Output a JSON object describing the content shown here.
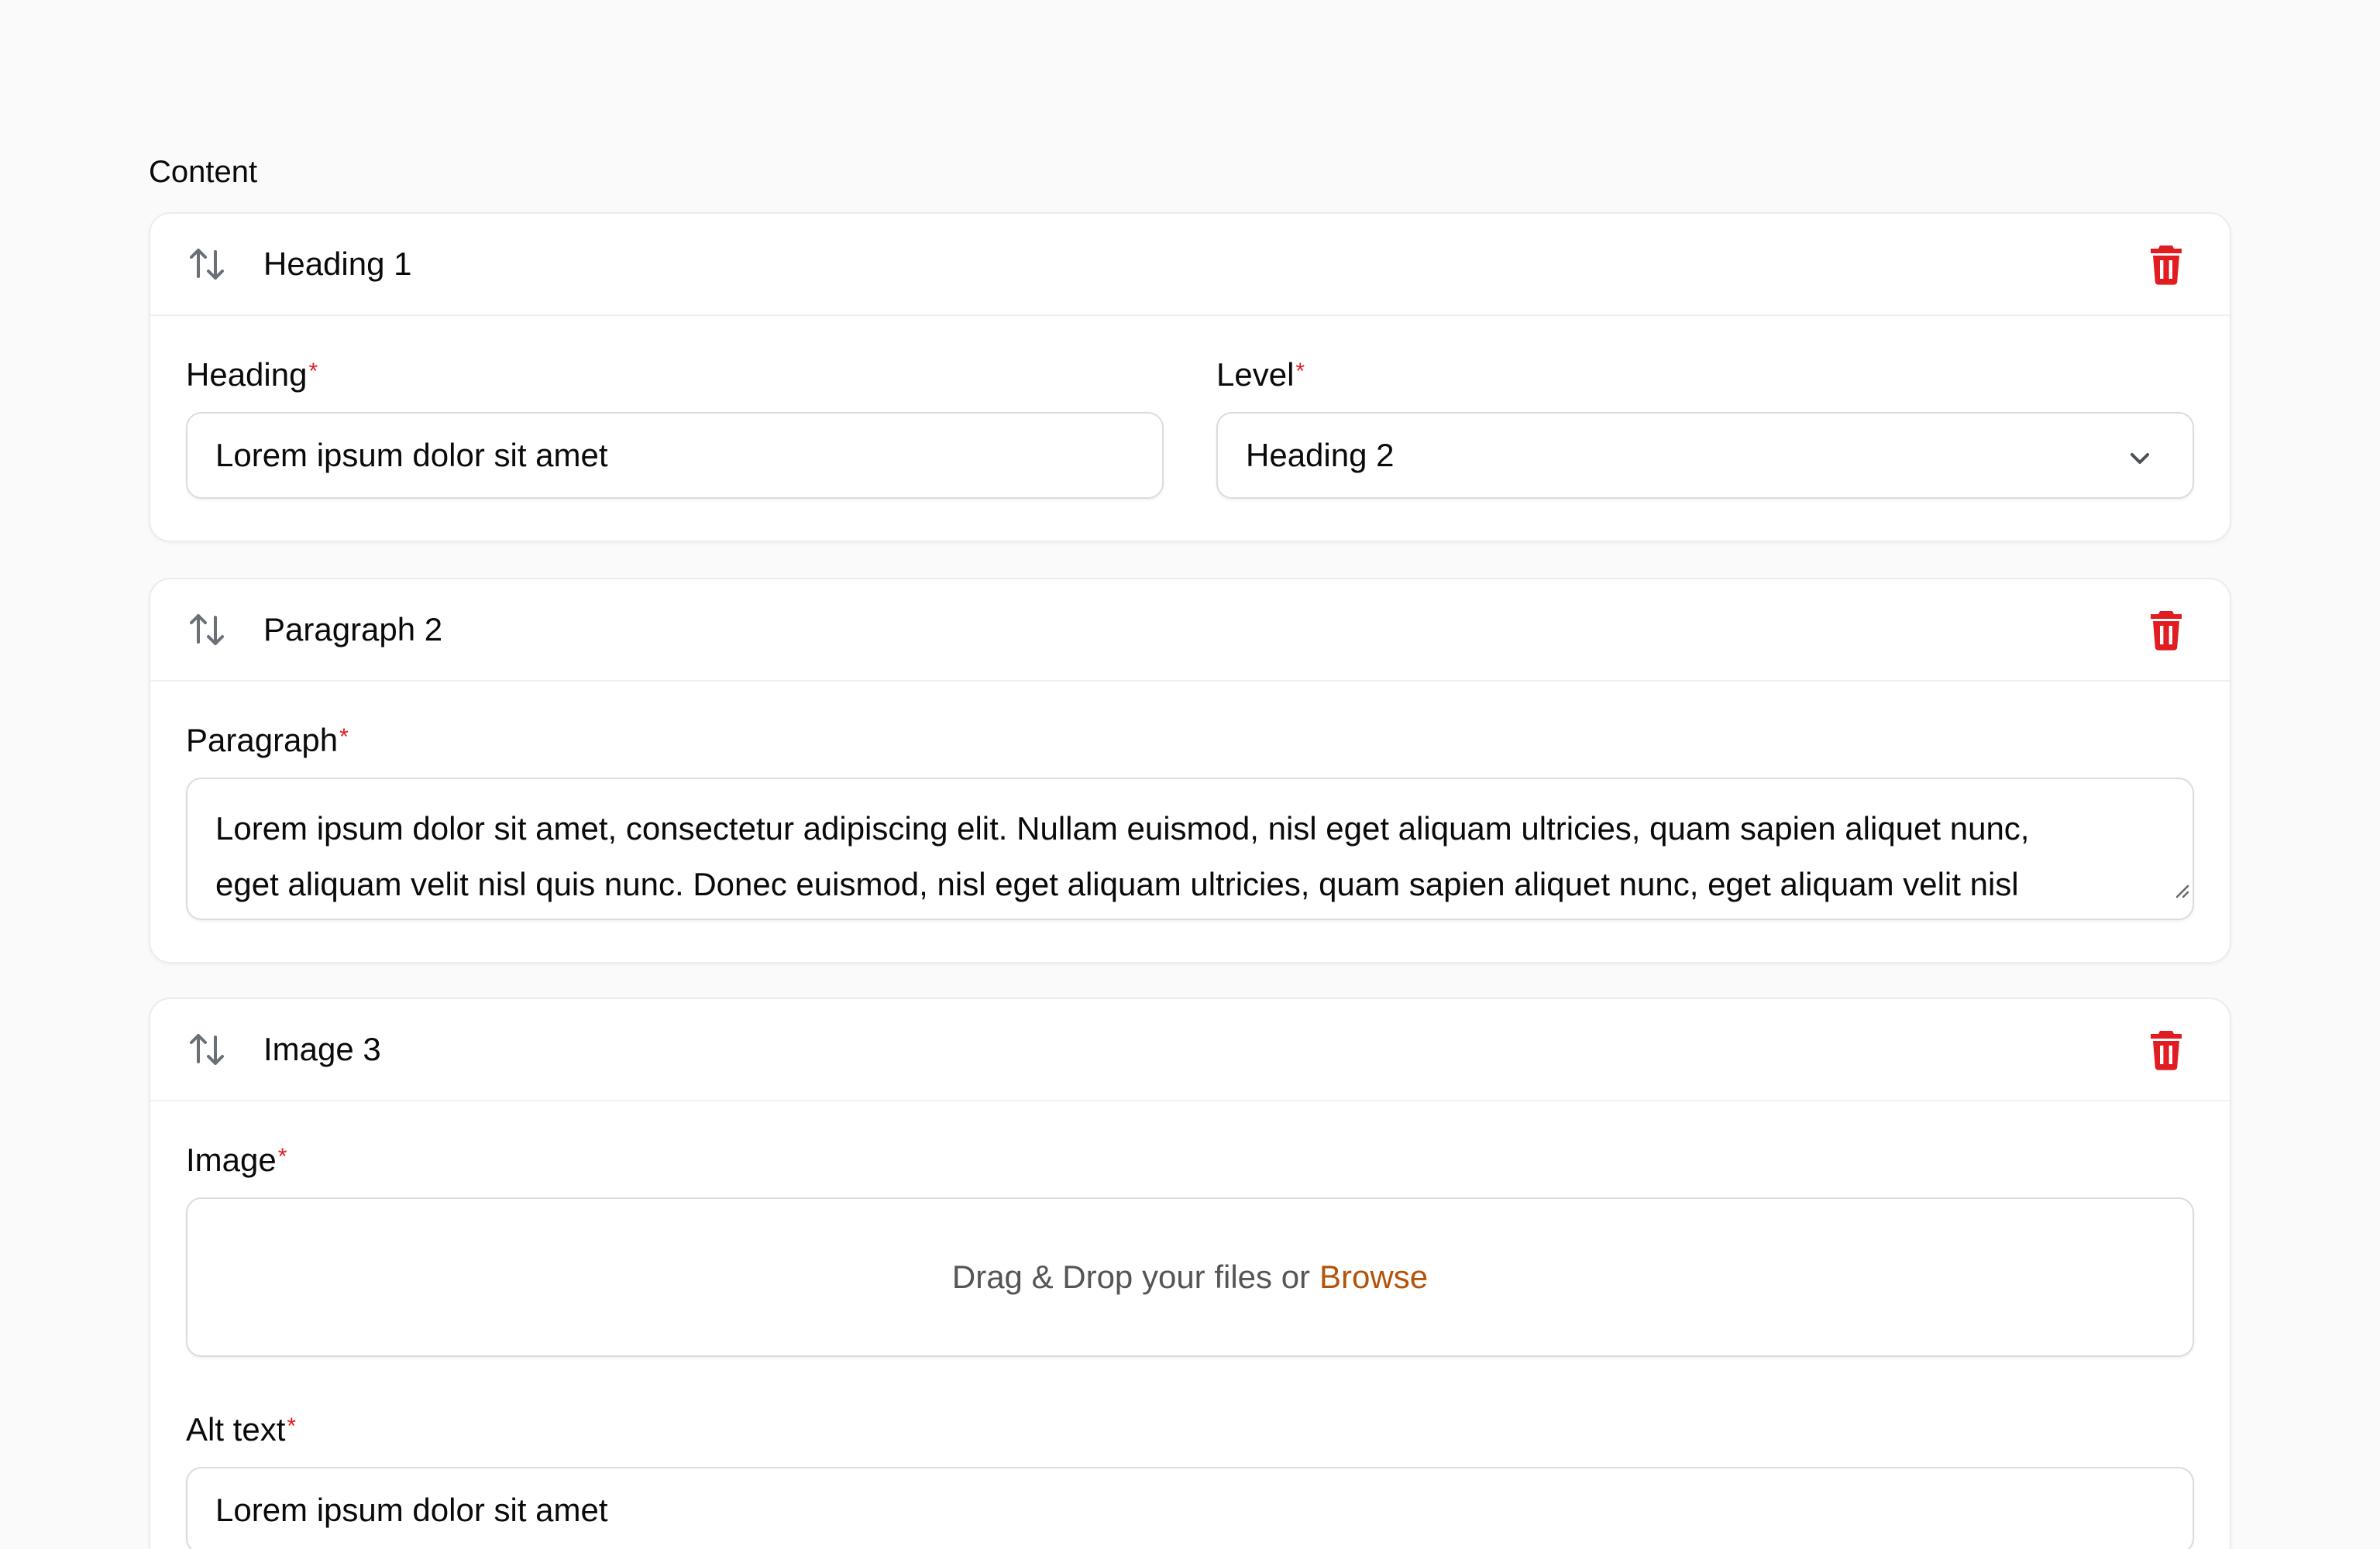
{
  "section": {
    "label": "Content"
  },
  "colors": {
    "required": "#dc1e1e",
    "trash": "#e11d22",
    "link": "#b45309",
    "icon": "#6b6f76"
  },
  "blocks": [
    {
      "title": "Heading 1",
      "fields": {
        "heading_label": "Heading",
        "heading_value": "Lorem ipsum dolor sit amet",
        "level_label": "Level",
        "level_value": "Heading 2"
      }
    },
    {
      "title": "Paragraph 2",
      "fields": {
        "paragraph_label": "Paragraph",
        "paragraph_line1": "Lorem ipsum dolor sit amet, consectetur adipiscing elit. Nullam euismod, nisl eget aliquam ultricies, quam sapien aliquet nunc,",
        "paragraph_line2": "eget aliquam velit nisl quis nunc. Donec euismod, nisl eget aliquam ultricies, quam sapien aliquet nunc, eget aliquam velit nisl"
      }
    },
    {
      "title": "Image 3",
      "fields": {
        "image_label": "Image",
        "dropzone_text": "Drag & Drop your files or",
        "browse_label": "Browse",
        "alt_label": "Alt text",
        "alt_value": "Lorem ipsum dolor sit amet"
      }
    }
  ],
  "required_marker": "*",
  "icons": {
    "reorder": "arrows-up-down-icon",
    "delete": "trash-icon",
    "dropdown": "chevron-down-icon"
  }
}
